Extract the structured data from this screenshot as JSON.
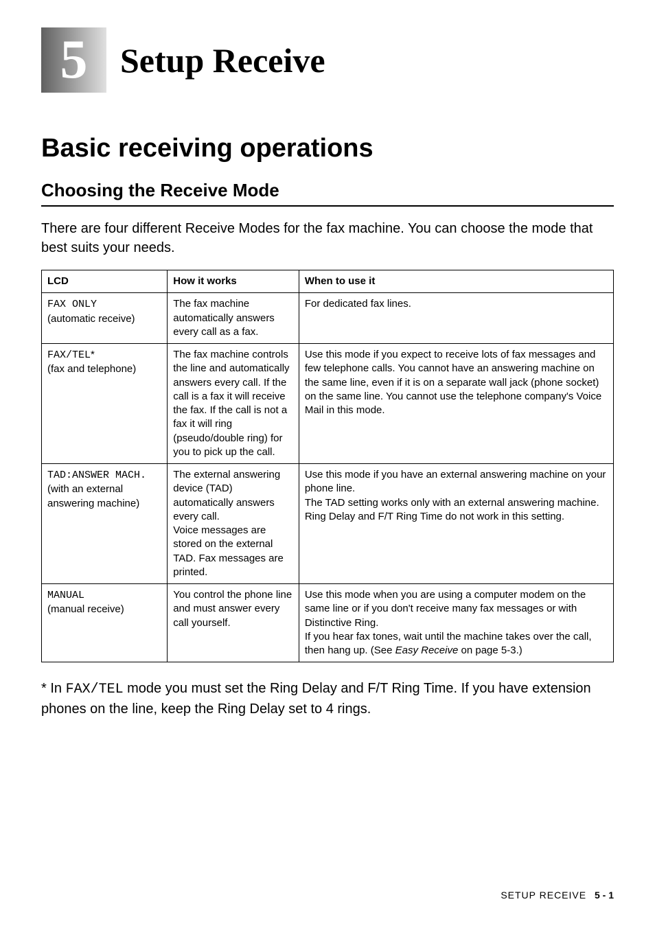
{
  "chapter": {
    "number": "5",
    "title": "Setup Receive"
  },
  "section": {
    "heading": "Basic receiving operations"
  },
  "subsection": {
    "heading": "Choosing the Receive Mode"
  },
  "intro_text": "There are four different Receive Modes for the fax machine. You can choose the mode that best suits your needs.",
  "table": {
    "headers": {
      "lcd": "LCD",
      "how": "How it works",
      "when": "When to use it"
    },
    "rows": [
      {
        "lcd_code": "FAX ONLY",
        "lcd_sub": "(automatic receive)",
        "how": "The fax machine automatically answers every call as a fax.",
        "when": "For dedicated fax lines."
      },
      {
        "lcd_code": "FAX/TEL",
        "lcd_star": "*",
        "lcd_sub": "(fax and telephone)",
        "how": "The fax machine controls the line and automatically answers every call. If the call is a fax it will receive the fax. If the call is not a fax it will ring (pseudo/double ring) for you to pick up the call.",
        "when": "Use this mode if you expect to receive lots of fax messages and few telephone calls. You cannot have an answering machine on the same line, even if it is on a separate wall jack (phone socket) on the same line. You cannot use the telephone company's Voice Mail in this mode."
      },
      {
        "lcd_code": "TAD:ANSWER MACH.",
        "lcd_sub": "(with an external answering machine)",
        "how": "The external answering device (TAD) automatically answers every call.\nVoice messages are stored on the external TAD. Fax messages are printed.",
        "when": "Use this mode if you have an external answering machine on your phone line.\nThe TAD setting works only with an external answering machine. Ring Delay and F/T Ring Time do not work in this setting."
      },
      {
        "lcd_code": "MANUAL",
        "lcd_sub": "(manual receive)",
        "how": "You control the phone line and must answer every call yourself.",
        "when_pre": "Use this mode when you are using a computer modem on the same line or if you don't receive many fax messages or with Distinctive Ring.\nIf you hear fax tones, wait until the machine takes over the call, then hang up. (See ",
        "when_italic": "Easy Receive",
        "when_post": " on page 5-3.)"
      }
    ]
  },
  "footnote": {
    "pre": "* In ",
    "code": "FAX/TEL",
    "post": " mode you must set the Ring Delay and F/T Ring Time. If you have extension phones on the line, keep the Ring Delay set to 4 rings."
  },
  "footer": {
    "label": "SETUP RECEIVE",
    "page": "5 - 1"
  }
}
